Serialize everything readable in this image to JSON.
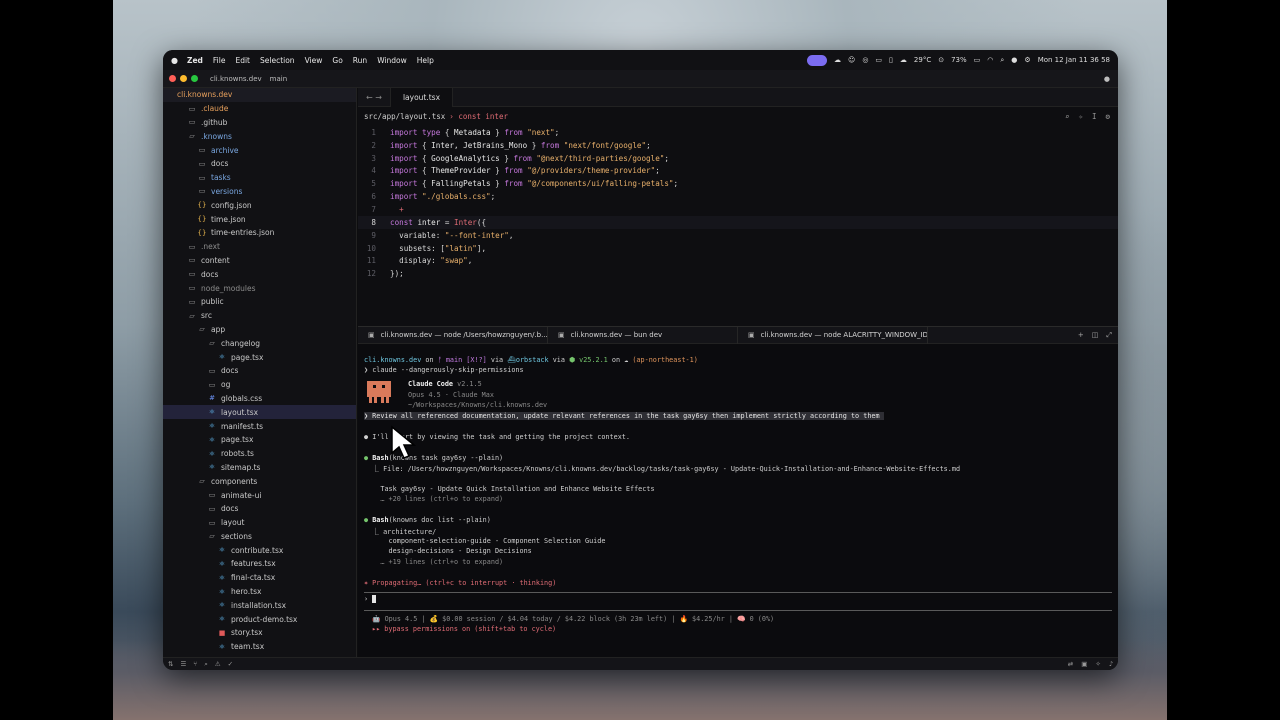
{
  "menubar": {
    "app_name": "Zed",
    "items": [
      "File",
      "Edit",
      "Selection",
      "View",
      "Go",
      "Run",
      "Window",
      "Help"
    ],
    "temperature": "29°C",
    "battery": "73%",
    "clock": "Mon 12 Jan  11 36 58"
  },
  "titlebar": {
    "project": "cli.knowns.dev",
    "branch": "main"
  },
  "sidebar": {
    "root": "cli.knowns.dev",
    "items": [
      {
        "label": ".claude",
        "depth": 1,
        "icon": "folder-icon",
        "color": "orange"
      },
      {
        "label": ".github",
        "depth": 1,
        "icon": "folder-icon",
        "color": "default"
      },
      {
        "label": ".knowns",
        "depth": 1,
        "icon": "folder-open-icon",
        "color": "blue"
      },
      {
        "label": "archive",
        "depth": 2,
        "icon": "folder-icon",
        "color": "blue"
      },
      {
        "label": "docs",
        "depth": 2,
        "icon": "folder-icon",
        "color": "default"
      },
      {
        "label": "tasks",
        "depth": 2,
        "icon": "folder-icon",
        "color": "blue"
      },
      {
        "label": "versions",
        "depth": 2,
        "icon": "folder-icon",
        "color": "blue"
      },
      {
        "label": "config.json",
        "depth": 2,
        "icon": "json-file-icon",
        "color": "default"
      },
      {
        "label": "time.json",
        "depth": 2,
        "icon": "json-file-icon",
        "color": "default"
      },
      {
        "label": "time-entries.json",
        "depth": 2,
        "icon": "json-file-icon",
        "color": "default"
      },
      {
        "label": ".next",
        "depth": 1,
        "icon": "folder-icon",
        "color": "grey"
      },
      {
        "label": "content",
        "depth": 1,
        "icon": "folder-icon",
        "color": "default"
      },
      {
        "label": "docs",
        "depth": 1,
        "icon": "folder-icon",
        "color": "default"
      },
      {
        "label": "node_modules",
        "depth": 1,
        "icon": "folder-icon",
        "color": "grey"
      },
      {
        "label": "public",
        "depth": 1,
        "icon": "folder-icon",
        "color": "default"
      },
      {
        "label": "src",
        "depth": 1,
        "icon": "folder-open-icon",
        "color": "default"
      },
      {
        "label": "app",
        "depth": 2,
        "icon": "folder-open-icon",
        "color": "default"
      },
      {
        "label": "changelog",
        "depth": 3,
        "icon": "folder-open-icon",
        "color": "default"
      },
      {
        "label": "page.tsx",
        "depth": 4,
        "icon": "react-file-icon",
        "color": "default"
      },
      {
        "label": "docs",
        "depth": 3,
        "icon": "folder-icon",
        "color": "default"
      },
      {
        "label": "og",
        "depth": 3,
        "icon": "folder-icon",
        "color": "default"
      },
      {
        "label": "globals.css",
        "depth": 3,
        "icon": "css-file-icon",
        "color": "default"
      },
      {
        "label": "layout.tsx",
        "depth": 3,
        "icon": "react-file-icon",
        "color": "default",
        "selected": true
      },
      {
        "label": "manifest.ts",
        "depth": 3,
        "icon": "react-file-icon",
        "color": "default"
      },
      {
        "label": "page.tsx",
        "depth": 3,
        "icon": "react-file-icon",
        "color": "default"
      },
      {
        "label": "robots.ts",
        "depth": 3,
        "icon": "react-file-icon",
        "color": "default"
      },
      {
        "label": "sitemap.ts",
        "depth": 3,
        "icon": "react-file-icon",
        "color": "default"
      },
      {
        "label": "components",
        "depth": 2,
        "icon": "folder-open-icon",
        "color": "default"
      },
      {
        "label": "animate-ui",
        "depth": 3,
        "icon": "folder-icon",
        "color": "default"
      },
      {
        "label": "docs",
        "depth": 3,
        "icon": "folder-icon",
        "color": "default"
      },
      {
        "label": "layout",
        "depth": 3,
        "icon": "folder-icon",
        "color": "default"
      },
      {
        "label": "sections",
        "depth": 3,
        "icon": "folder-open-icon",
        "color": "default"
      },
      {
        "label": "contribute.tsx",
        "depth": 4,
        "icon": "react-file-icon",
        "color": "default"
      },
      {
        "label": "features.tsx",
        "depth": 4,
        "icon": "react-file-icon",
        "color": "default"
      },
      {
        "label": "final-cta.tsx",
        "depth": 4,
        "icon": "react-file-icon",
        "color": "default"
      },
      {
        "label": "hero.tsx",
        "depth": 4,
        "icon": "react-file-icon",
        "color": "default"
      },
      {
        "label": "installation.tsx",
        "depth": 4,
        "icon": "react-file-icon",
        "color": "default"
      },
      {
        "label": "product-demo.tsx",
        "depth": 4,
        "icon": "react-file-icon",
        "color": "default"
      },
      {
        "label": "story.tsx",
        "depth": 4,
        "icon": "story-file-icon",
        "color": "default"
      },
      {
        "label": "team.tsx",
        "depth": 4,
        "icon": "react-file-icon",
        "color": "default"
      }
    ]
  },
  "editor": {
    "tab": "layout.tsx",
    "breadcrumb_path": "src/app/layout.tsx",
    "breadcrumb_symbol": "const inter",
    "lines": [
      {
        "n": "1",
        "tokens": [
          [
            "kw",
            "import "
          ],
          [
            "kw",
            "type "
          ],
          [
            "pr",
            "{ "
          ],
          [
            "id",
            "Metadata"
          ],
          [
            "pr",
            " } "
          ],
          [
            "kw",
            "from "
          ],
          [
            "str",
            "\"next\""
          ],
          [
            "pr",
            ";"
          ]
        ]
      },
      {
        "n": "2",
        "tokens": [
          [
            "kw",
            "import "
          ],
          [
            "pr",
            "{ "
          ],
          [
            "id",
            "Inter, JetBrains_Mono"
          ],
          [
            "pr",
            " } "
          ],
          [
            "kw",
            "from "
          ],
          [
            "str",
            "\"next/font/google\""
          ],
          [
            "pr",
            ";"
          ]
        ]
      },
      {
        "n": "3",
        "tokens": [
          [
            "kw",
            "import "
          ],
          [
            "pr",
            "{ "
          ],
          [
            "id",
            "GoogleAnalytics"
          ],
          [
            "pr",
            " } "
          ],
          [
            "kw",
            "from "
          ],
          [
            "str",
            "\"@next/third-parties/google\""
          ],
          [
            "pr",
            ";"
          ]
        ]
      },
      {
        "n": "4",
        "tokens": [
          [
            "kw",
            "import "
          ],
          [
            "pr",
            "{ "
          ],
          [
            "id",
            "ThemeProvider"
          ],
          [
            "pr",
            " } "
          ],
          [
            "kw",
            "from "
          ],
          [
            "str",
            "\"@/providers/theme-provider\""
          ],
          [
            "pr",
            ";"
          ]
        ]
      },
      {
        "n": "5",
        "tokens": [
          [
            "kw",
            "import "
          ],
          [
            "pr",
            "{ "
          ],
          [
            "id",
            "FallingPetals"
          ],
          [
            "pr",
            " } "
          ],
          [
            "kw",
            "from "
          ],
          [
            "str",
            "\"@/components/ui/falling-petals\""
          ],
          [
            "pr",
            ";"
          ]
        ]
      },
      {
        "n": "6",
        "tokens": [
          [
            "kw",
            "import "
          ],
          [
            "str",
            "\"./globals.css\""
          ],
          [
            "pr",
            ";"
          ]
        ]
      },
      {
        "n": "7",
        "tokens": [
          [
            "fn",
            "  +"
          ]
        ]
      },
      {
        "n": "8",
        "tokens": [
          [
            "kw",
            "const "
          ],
          [
            "id",
            "inter"
          ],
          [
            "pr",
            " = "
          ],
          [
            "fn",
            "Inter"
          ],
          [
            "pr",
            "({"
          ]
        ]
      },
      {
        "n": "9",
        "tokens": [
          [
            "pr",
            "  variable: "
          ],
          [
            "str",
            "\"--font-inter\""
          ],
          [
            "pr",
            ","
          ]
        ]
      },
      {
        "n": "10",
        "tokens": [
          [
            "pr",
            "  subsets: ["
          ],
          [
            "str",
            "\"latin\""
          ],
          [
            "pr",
            "],"
          ]
        ]
      },
      {
        "n": "11",
        "tokens": [
          [
            "pr",
            "  display: "
          ],
          [
            "str",
            "\"swap\""
          ],
          [
            "pr",
            ","
          ]
        ]
      },
      {
        "n": "12",
        "tokens": [
          [
            "pr",
            "});"
          ]
        ]
      }
    ]
  },
  "terminal": {
    "tabs": [
      "cli.knowns.dev — node /Users/howznguyen/.b...",
      "cli.knowns.dev — bun dev",
      "cli.knowns.dev — node ALACRITTY_WINDOW_ID=..."
    ],
    "prompt": {
      "dir": "cli.knowns.dev",
      "on": "on",
      "branch": "main [X!?]",
      "via": "via",
      "orbstack": "orbstack",
      "node_ver": "v25.2.1",
      "region": "(ap-northeast-1)"
    },
    "command": "claude --dangerously-skip-permissions",
    "claude": {
      "title": "Claude Code",
      "version": "v2.1.5",
      "model": "Opus 4.5 · Claude Max",
      "path": "~/Workspaces/Knowns/cli.knowns.dev"
    },
    "user_prompt": "❯ Review all referenced documentation, update relevant references in the task gay6sy then implement strictly according to them",
    "reply1": "I'll start by viewing the task and getting the project context.",
    "bash1_label": "Bash",
    "bash1_cmd": "(knowns task gay6sy --plain)",
    "bash1_out1": "  ⎿ File: /Users/howznguyen/Workspaces/Knowns/cli.knowns.dev/backlog/tasks/task-gay6sy - Update-Quick-Installation-and-Enhance-Website-Effects.md",
    "bash1_out2": "    Task gay6sy - Update Quick Installation and Enhance Website Effects",
    "bash1_out3": "    … +20 lines (ctrl+o to expand)",
    "bash2_label": "Bash",
    "bash2_cmd": "(knowns doc list --plain)",
    "bash2_out1": "  ⎿ architecture/",
    "bash2_out2": "      component-selection-guide - Component Selection Guide",
    "bash2_out3": "      design-decisions - Design Decisions",
    "bash2_out4": "    … +19 lines (ctrl+o to expand)",
    "thinking": "✶ Propagating… (ctrl+c to interrupt · thinking)",
    "input_prompt": "›",
    "status_line": "Opus 4.5 | 💰 $0.00 session / $4.04 today / $4.22 block (3h 23m left) | 🔥 $4.25/hr | 🧠 0 (0%)",
    "bypass_line": "▸▸ bypass permissions on (shift+tab to cycle)"
  }
}
